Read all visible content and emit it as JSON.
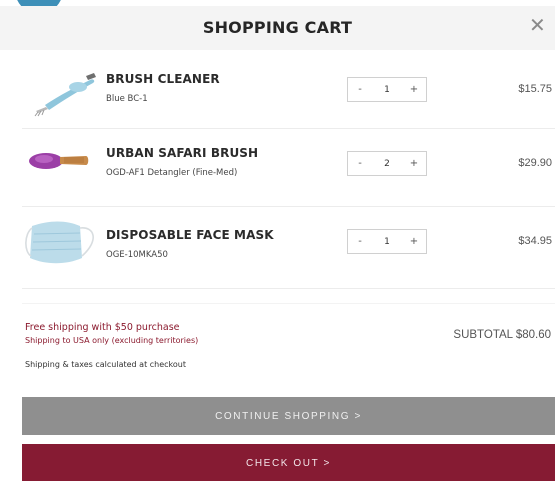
{
  "header": {
    "title": "SHOPPING CART",
    "close_symbol": "✕"
  },
  "items": [
    {
      "name": "BRUSH CLEANER",
      "variant": "Blue BC-1",
      "quantity": "1",
      "price": "$15.75",
      "image": "brush-cleaner-image"
    },
    {
      "name": "URBAN SAFARI BRUSH",
      "variant": "OGD-AF1 Detangler (Fine-Med)",
      "quantity": "2",
      "price": "$29.90",
      "image": "detangler-brush-image"
    },
    {
      "name": "DISPOSABLE FACE MASK",
      "variant": "OGE-10MKA50",
      "quantity": "1",
      "price": "$34.95",
      "image": "face-mask-image"
    }
  ],
  "qty_controls": {
    "minus": "-",
    "plus": "+"
  },
  "summary": {
    "free_shipping": "Free shipping with $50 purchase",
    "shipping_region": "Shipping to USA only (excluding territories)",
    "shipping_taxes": "Shipping & taxes calculated at checkout",
    "subtotal": "SUBTOTAL $80.60"
  },
  "buttons": {
    "continue": "CONTINUE SHOPPING >",
    "checkout": "CHECK OUT >"
  },
  "colors": {
    "accent": "#861b33",
    "continue_bg": "#8f8f8f",
    "header_bg": "#f4f4f4",
    "promo_text": "#8b1a2e"
  }
}
